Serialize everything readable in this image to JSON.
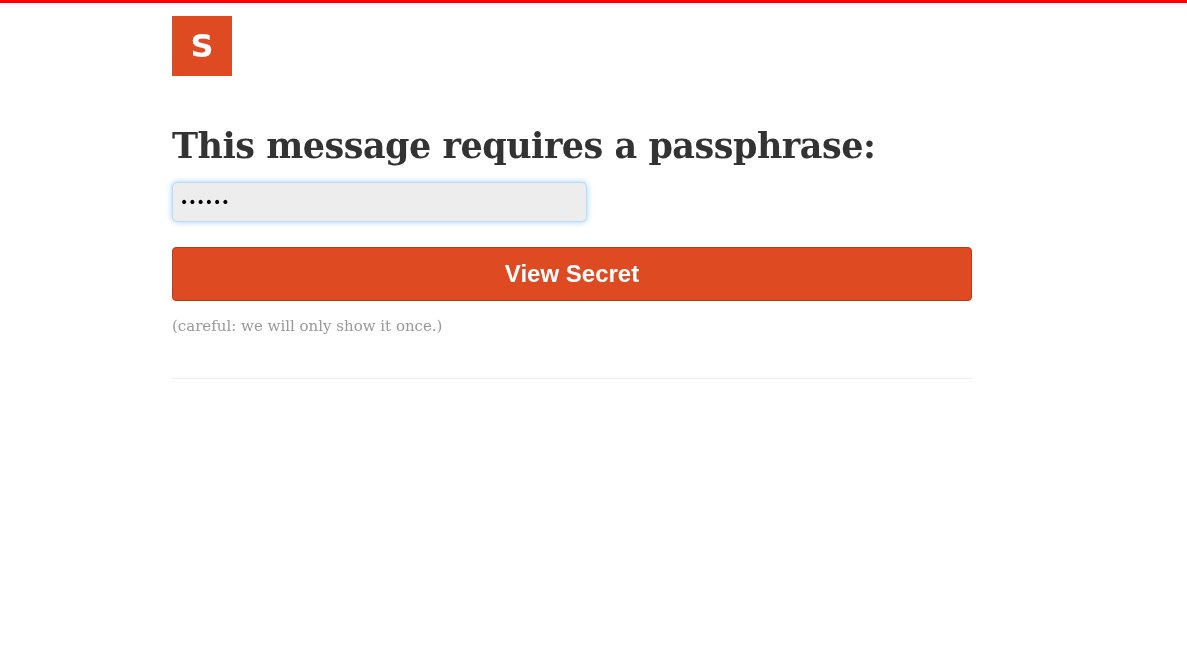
{
  "logo": {
    "letter": "S"
  },
  "heading": "This message requires a passphrase:",
  "passphrase_field": {
    "value": "••••••",
    "focused": true
  },
  "button": {
    "label": "View Secret"
  },
  "note": "(careful: we will only show it once.)"
}
